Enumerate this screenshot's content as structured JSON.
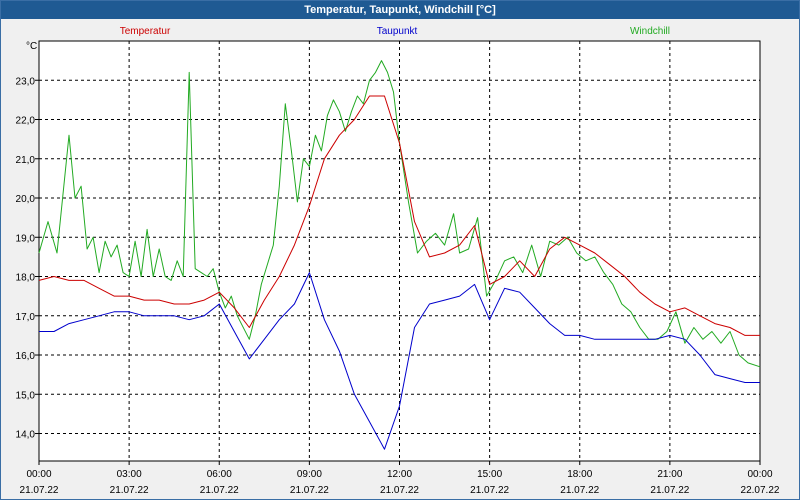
{
  "chart_data": {
    "type": "line",
    "title": "Temperatur, Taupunkt, Windchill [°C]",
    "ylabel": "°C",
    "ylim": [
      13.3,
      24.0
    ],
    "yticks": [
      "14,0",
      "15,0",
      "16,0",
      "17,0",
      "18,0",
      "19,0",
      "20,0",
      "21,0",
      "22,0",
      "23,0"
    ],
    "xlim": [
      0,
      24
    ],
    "xticks": [
      {
        "time": "00:00",
        "date": "21.07.22"
      },
      {
        "time": "03:00",
        "date": "21.07.22"
      },
      {
        "time": "06:00",
        "date": "21.07.22"
      },
      {
        "time": "09:00",
        "date": "21.07.22"
      },
      {
        "time": "12:00",
        "date": "21.07.22"
      },
      {
        "time": "15:00",
        "date": "21.07.22"
      },
      {
        "time": "18:00",
        "date": "21.07.22"
      },
      {
        "time": "21:00",
        "date": "21.07.22"
      },
      {
        "time": "00:00",
        "date": "22.07.22"
      }
    ],
    "grid": true,
    "legend": "top",
    "series": [
      {
        "name": "Temperatur",
        "color": "#cc0000",
        "x": [
          0,
          0.5,
          1,
          1.5,
          2,
          2.5,
          3,
          3.5,
          4,
          4.5,
          5,
          5.5,
          6,
          6.5,
          7,
          7.5,
          8,
          8.5,
          9,
          9.5,
          10,
          10.5,
          11,
          11.5,
          12,
          12.5,
          13,
          13.5,
          14,
          14.5,
          15,
          15.5,
          16,
          16.5,
          17,
          17.5,
          18,
          18.5,
          19,
          19.5,
          20,
          20.5,
          21,
          21.5,
          22,
          22.5,
          23,
          23.5,
          24
        ],
        "values": [
          17.9,
          18.0,
          17.9,
          17.9,
          17.7,
          17.5,
          17.5,
          17.4,
          17.4,
          17.3,
          17.3,
          17.4,
          17.6,
          17.2,
          16.7,
          17.4,
          18.0,
          18.8,
          19.8,
          21.0,
          21.6,
          22.0,
          22.6,
          22.6,
          21.4,
          19.4,
          18.5,
          18.6,
          18.8,
          19.3,
          17.8,
          18.0,
          18.4,
          18.0,
          18.7,
          19.0,
          18.8,
          18.6,
          18.3,
          18.0,
          17.6,
          17.3,
          17.1,
          17.2,
          17.0,
          16.8,
          16.7,
          16.5,
          16.5
        ]
      },
      {
        "name": "Taupunkt",
        "color": "#0000cc",
        "x": [
          0,
          0.5,
          1,
          1.5,
          2,
          2.5,
          3,
          3.5,
          4,
          4.5,
          5,
          5.5,
          6,
          6.5,
          7,
          7.5,
          8,
          8.5,
          9,
          9.5,
          10,
          10.5,
          11,
          11.5,
          12,
          12.5,
          13,
          13.5,
          14,
          14.5,
          15,
          15.5,
          16,
          16.5,
          17,
          17.5,
          18,
          18.5,
          19,
          19.5,
          20,
          20.5,
          21,
          21.5,
          22,
          22.5,
          23,
          23.5,
          24
        ],
        "values": [
          16.6,
          16.6,
          16.8,
          16.9,
          17.0,
          17.1,
          17.1,
          17.0,
          17.0,
          17.0,
          16.9,
          17.0,
          17.3,
          16.6,
          15.9,
          16.4,
          16.9,
          17.3,
          18.1,
          16.9,
          16.1,
          15.0,
          14.3,
          13.6,
          14.7,
          16.7,
          17.3,
          17.4,
          17.5,
          17.8,
          16.9,
          17.7,
          17.6,
          17.2,
          16.8,
          16.5,
          16.5,
          16.4,
          16.4,
          16.4,
          16.4,
          16.4,
          16.5,
          16.4,
          16.0,
          15.5,
          15.4,
          15.3,
          15.3
        ]
      },
      {
        "name": "Windchill",
        "color": "#22aa22",
        "x": [
          0,
          0.3,
          0.6,
          1,
          1.2,
          1.4,
          1.6,
          1.8,
          2,
          2.2,
          2.4,
          2.6,
          2.8,
          3,
          3.2,
          3.4,
          3.6,
          3.8,
          4,
          4.2,
          4.4,
          4.6,
          4.8,
          5,
          5.2,
          5.4,
          5.6,
          5.8,
          6,
          6.2,
          6.4,
          6.6,
          7,
          7.2,
          7.4,
          7.8,
          8,
          8.2,
          8.4,
          8.6,
          8.8,
          9,
          9.2,
          9.4,
          9.6,
          9.8,
          10,
          10.2,
          10.4,
          10.6,
          10.8,
          11,
          11.2,
          11.4,
          11.6,
          11.8,
          12,
          12.3,
          12.6,
          12.9,
          13.2,
          13.5,
          13.8,
          14,
          14.3,
          14.6,
          14.9,
          15.2,
          15.5,
          15.8,
          16.1,
          16.4,
          16.7,
          17,
          17.3,
          17.6,
          17.9,
          18.2,
          18.5,
          18.8,
          19.1,
          19.4,
          19.7,
          20,
          20.3,
          20.6,
          20.9,
          21.2,
          21.5,
          21.8,
          22.1,
          22.4,
          22.7,
          23,
          23.3,
          23.6,
          24
        ],
        "values": [
          18.6,
          19.4,
          18.6,
          21.6,
          20.0,
          20.3,
          18.7,
          19.0,
          18.1,
          18.9,
          18.5,
          18.8,
          18.1,
          18.0,
          18.9,
          18.0,
          19.2,
          18.0,
          18.7,
          18.0,
          17.9,
          18.4,
          18.0,
          23.2,
          18.2,
          18.1,
          18.0,
          18.2,
          17.6,
          17.2,
          17.5,
          17.0,
          16.4,
          17.0,
          17.8,
          18.8,
          20.3,
          22.4,
          21.2,
          19.9,
          21.0,
          20.8,
          21.6,
          21.2,
          22.1,
          22.5,
          22.2,
          21.7,
          22.2,
          22.6,
          22.4,
          23.0,
          23.2,
          23.5,
          23.2,
          22.7,
          21.4,
          19.9,
          18.6,
          18.9,
          19.1,
          18.8,
          19.6,
          18.6,
          18.7,
          19.5,
          17.5,
          17.9,
          18.4,
          18.5,
          18.1,
          18.8,
          18.0,
          18.9,
          18.8,
          19.0,
          18.6,
          18.4,
          18.5,
          18.1,
          17.8,
          17.3,
          17.1,
          16.7,
          16.4,
          16.4,
          16.6,
          17.1,
          16.3,
          16.7,
          16.4,
          16.6,
          16.3,
          16.6,
          16.0,
          15.8,
          15.7
        ]
      }
    ]
  }
}
